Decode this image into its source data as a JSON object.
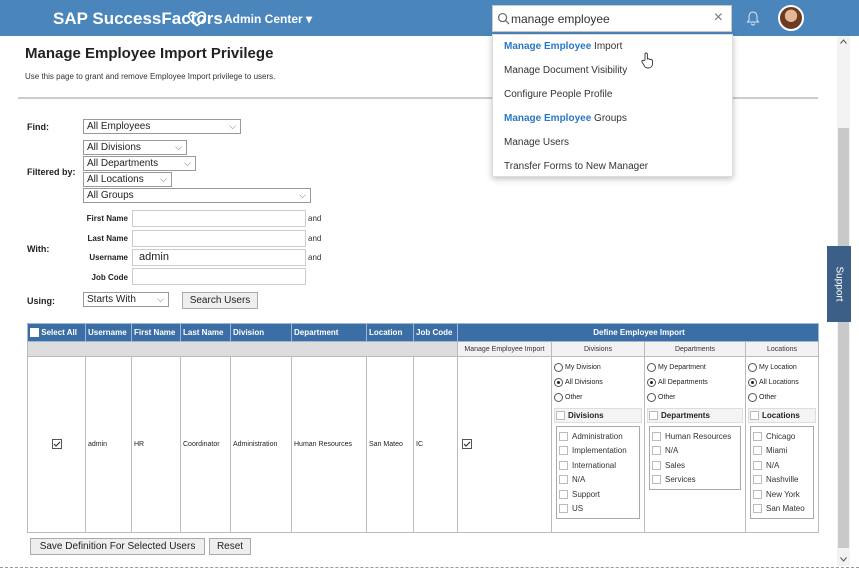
{
  "header": {
    "brand": "SAP SuccessFactors",
    "module": "Admin Center ▾",
    "search_value": "manage employee",
    "search_clear": "×"
  },
  "search_results": [
    {
      "bold": "Manage Employee",
      "rest": " Import"
    },
    {
      "bold": "",
      "rest": "Manage Document Visibility"
    },
    {
      "bold": "",
      "rest": "Configure People Profile"
    },
    {
      "bold": "Manage Employee",
      "rest": " Groups"
    },
    {
      "bold": "",
      "rest": "Manage Users"
    },
    {
      "bold": "",
      "rest": "Transfer Forms to New Manager"
    }
  ],
  "page": {
    "title": "Manage Employee Import Privilege",
    "description": "Use this page to grant and remove Employee Import privilege to users."
  },
  "filters": {
    "find_label": "Find:",
    "find_value": "All Employees",
    "filtered_by_label": "Filtered by:",
    "division": "All Divisions",
    "department": "All Departments",
    "location": "All Locations",
    "group": "All Groups",
    "with_label": "With:",
    "first_name_label": "First Name",
    "last_name_label": "Last Name",
    "username_label": "Username",
    "username_value": "admin",
    "job_code_label": "Job Code",
    "and_text": "and",
    "using_label": "Using:",
    "using_value": "Starts With",
    "search_button": "Search Users"
  },
  "table": {
    "select_all": "Select All",
    "columns": [
      "Username",
      "First Name",
      "Last Name",
      "Division",
      "Department",
      "Location",
      "Job Code"
    ],
    "define_header": "Define Employee Import",
    "sub_headers": [
      "Manage Employee Import",
      "Divisions",
      "Departments",
      "Locations"
    ],
    "row": {
      "username": "admin",
      "first_name": "HR",
      "last_name": "Coordinator",
      "division": "Administration",
      "department": "Human Resources",
      "location": "San Mateo",
      "job_code": "IC"
    },
    "divisions": {
      "radios": [
        "My Division",
        "All Divisions",
        "Other"
      ],
      "selected": 1,
      "box_title": "Divisions",
      "items": [
        "Administration",
        "Implementation",
        "International",
        "N/A",
        "Support",
        "US"
      ]
    },
    "departments": {
      "radios": [
        "My Department",
        "All Departments",
        "Other"
      ],
      "selected": 1,
      "box_title": "Departments",
      "items": [
        "Human Resources",
        "N/A",
        "Sales",
        "Services"
      ]
    },
    "locations": {
      "radios": [
        "My Location",
        "All Locations",
        "Other"
      ],
      "selected": 1,
      "box_title": "Locations",
      "items": [
        "Chicago",
        "Miami",
        "N/A",
        "Nashville",
        "New York",
        "San Mateo"
      ]
    }
  },
  "actions": {
    "save_button": "Save Definition For Selected Users",
    "reset_button": "Reset"
  },
  "support_tab": "Support",
  "colors": {
    "header_blue": "#4a86bb",
    "table_header": "#3a6ea5",
    "highlight": "#2a78c4"
  }
}
